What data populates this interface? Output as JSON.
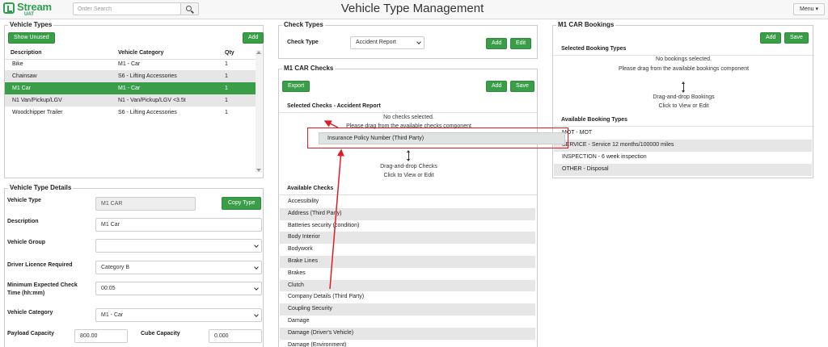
{
  "header": {
    "logo_main": "Stream",
    "logo_sub": "UAT",
    "search_placeholder": "Order Search",
    "title": "Vehicle Type Management",
    "menu_label": "Menu ▾"
  },
  "vehicle_types": {
    "title": "Vehicle Types",
    "show_unused_label": "Show Unused",
    "add_label": "Add",
    "columns": [
      "Description",
      "Vehicle Category",
      "Qty"
    ],
    "rows": [
      {
        "description": "Bike",
        "category": "M1 - Car",
        "qty": "1"
      },
      {
        "description": "Chainsaw",
        "category": "S6 - Lifting Accessories",
        "qty": "1"
      },
      {
        "description": "M1 Car",
        "category": "M1 - Car",
        "qty": "1"
      },
      {
        "description": "N1 Van/Pickup/LGV",
        "category": "N1 - Van/Pickup/LGV <3.5t",
        "qty": "1"
      },
      {
        "description": "Woodchipper Trailer",
        "category": "S6 - Lifting Accessories",
        "qty": "1"
      }
    ]
  },
  "details": {
    "title": "Vehicle Type Details",
    "copy_label": "Copy Type",
    "fields": {
      "vehicle_type": {
        "label": "Vehicle Type",
        "value": "M1 CAR"
      },
      "description": {
        "label": "Description",
        "value": "M1 Car"
      },
      "vehicle_group": {
        "label": "Vehicle Group",
        "value": ""
      },
      "driver_licence": {
        "label": "Driver Licence Required",
        "value": "Category B"
      },
      "min_check_time": {
        "label": "Minimum Expected Check Time (hh:mm)",
        "value": "00:05"
      },
      "vehicle_category": {
        "label": "Vehicle Category",
        "value": "M1 - Car"
      },
      "payload": {
        "label": "Payload Capacity",
        "value": "800.00"
      },
      "cube": {
        "label": "Cube Capacity",
        "value": "0.000"
      }
    }
  },
  "check_types": {
    "title": "Check Types",
    "label": "Check Type",
    "selected": "Accident Report",
    "add_label": "Add",
    "edit_label": "Edit"
  },
  "car_checks": {
    "title": "M1 CAR Checks",
    "export_label": "Export",
    "add_label": "Add",
    "save_label": "Save",
    "selected_heading": "Selected Checks - Accident Report",
    "empty_line1": "No checks selected.",
    "empty_line2": "Please drag from the available checks component",
    "dragging_item": "Insurance Policy Number (Third Party)",
    "dnd_line1": "Drag-and-drop Checks",
    "dnd_line2": "Click to View or Edit",
    "available_heading": "Available Checks",
    "available": [
      "Accessibility",
      "Address (Third Party)",
      "Batteries security (condition)",
      "Body Interior",
      "Bodywork",
      "Brake Lines",
      "Brakes",
      "Clutch",
      "Company Details (Third Party)",
      "Coupling Security",
      "Damage",
      "Damage (Driver's Vehicle)",
      "Damage (Environment)"
    ]
  },
  "bookings": {
    "title": "M1 CAR Bookings",
    "add_label": "Add",
    "save_label": "Save",
    "selected_heading": "Selected Booking Types",
    "empty_line1": "No bookings selected.",
    "empty_line2": "Please drag from the available bookings component",
    "dnd_line1": "Drag-and-drop Bookings",
    "dnd_line2": "Click to View or Edit",
    "available_heading": "Available Booking Types",
    "available": [
      "MOT - MOT",
      "SERVICE - Service 12 months/100000 miles",
      "INSPECTION - 6 week inspection",
      "OTHER - Disposal"
    ]
  },
  "colors": {
    "accent": "#3a9d48",
    "annotation": "#e01b24"
  }
}
